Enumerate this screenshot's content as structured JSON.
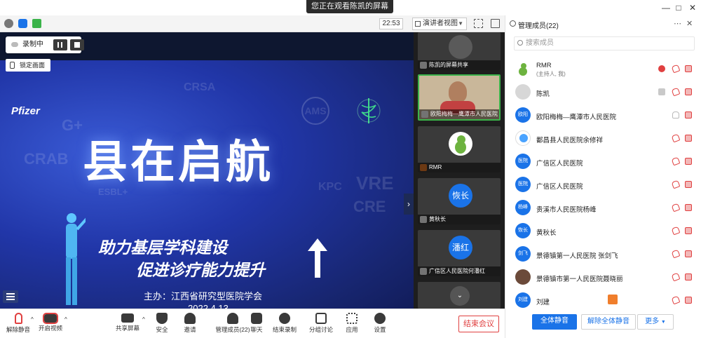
{
  "window": {
    "sharing_banner": "您正在观看陈凯的屏幕",
    "minimize_icon": "minimize-icon",
    "maximize_icon": "maximize-icon",
    "close_icon": "close-icon"
  },
  "meeting_bar": {
    "timer": "22:53",
    "view_mode": "演讲者视图"
  },
  "recording": {
    "label": "录制中",
    "lock_tip": "锁定画面"
  },
  "slide": {
    "logo": "Pfizer",
    "title": "县在启航",
    "subtitle_1": "助力基层学科建设",
    "subtitle_2": "促进诊疗能力提升",
    "host": "主办：江西省研究型医院学会",
    "date": "2022.4.13",
    "watermarks": [
      "AMS",
      "G+",
      "CRAB",
      "VRE",
      "ESBL+",
      "KPC",
      "CRE",
      "CRSA"
    ]
  },
  "video_tiles": [
    {
      "caption": "陈凯的屏幕共享",
      "type": "share"
    },
    {
      "caption": "欧阳梅梅—鹰潭市人民医院",
      "type": "camera"
    },
    {
      "caption": "RMR",
      "type": "avatar"
    },
    {
      "caption": "黄秋长",
      "avatar_text": "恢长",
      "type": "text"
    },
    {
      "caption": "广信区人民医院何潘红",
      "avatar_text": "潘红",
      "type": "text"
    },
    {
      "caption": "",
      "type": "partial"
    }
  ],
  "panel": {
    "title": "管理成员(22)",
    "search_placeholder": "搜索成员",
    "members": [
      {
        "name": "RMR",
        "sub": "(主持人, 我)",
        "avatar": ""
      },
      {
        "name": "陈凯",
        "sub": "",
        "avatar": ""
      },
      {
        "name": "欧阳梅梅—鹰潭市人民医院",
        "sub": "",
        "avatar": "欧阳"
      },
      {
        "name": "鄱昌县人民医院余修祥",
        "sub": "",
        "avatar": ""
      },
      {
        "name": "广信区人民医院",
        "sub": "",
        "avatar": "医院"
      },
      {
        "name": "广信区人民医院",
        "sub": "",
        "avatar": "医院"
      },
      {
        "name": "贵溪市人民医院杨峰",
        "sub": "",
        "avatar": "杨峰"
      },
      {
        "name": "黄秋长",
        "sub": "",
        "avatar": "恢长"
      },
      {
        "name": "景德镇第一人民医院 张剑飞",
        "sub": "",
        "avatar": "剑飞"
      },
      {
        "name": "景德镇市第一人民医院聂晓丽",
        "sub": "",
        "avatar": ""
      },
      {
        "name": "刘建",
        "sub": "",
        "avatar": "刘建"
      }
    ],
    "mute_all": "全体静音",
    "unmute_all": "解除全体静音",
    "more": "更多"
  },
  "toolbar": {
    "items": [
      {
        "label": "解除静音",
        "icon": "mic-off-icon"
      },
      {
        "label": "开启视频",
        "icon": "video-off-icon"
      },
      {
        "label": "共享屏幕",
        "icon": "share-screen-icon"
      },
      {
        "label": "安全",
        "icon": "shield-icon"
      },
      {
        "label": "邀请",
        "icon": "invite-icon"
      },
      {
        "label": "管理成员(22)",
        "icon": "members-icon"
      },
      {
        "label": "聊天",
        "icon": "chat-icon"
      },
      {
        "label": "结束录制",
        "icon": "record-icon"
      },
      {
        "label": "分组讨论",
        "icon": "breakout-icon"
      },
      {
        "label": "应用",
        "icon": "apps-icon"
      },
      {
        "label": "设置",
        "icon": "gear-icon"
      }
    ],
    "end_meeting": "结束会议"
  },
  "colors": {
    "accent_blue": "#1a73e8",
    "danger_red": "#e04040",
    "slide_blue": "#2136a8"
  }
}
